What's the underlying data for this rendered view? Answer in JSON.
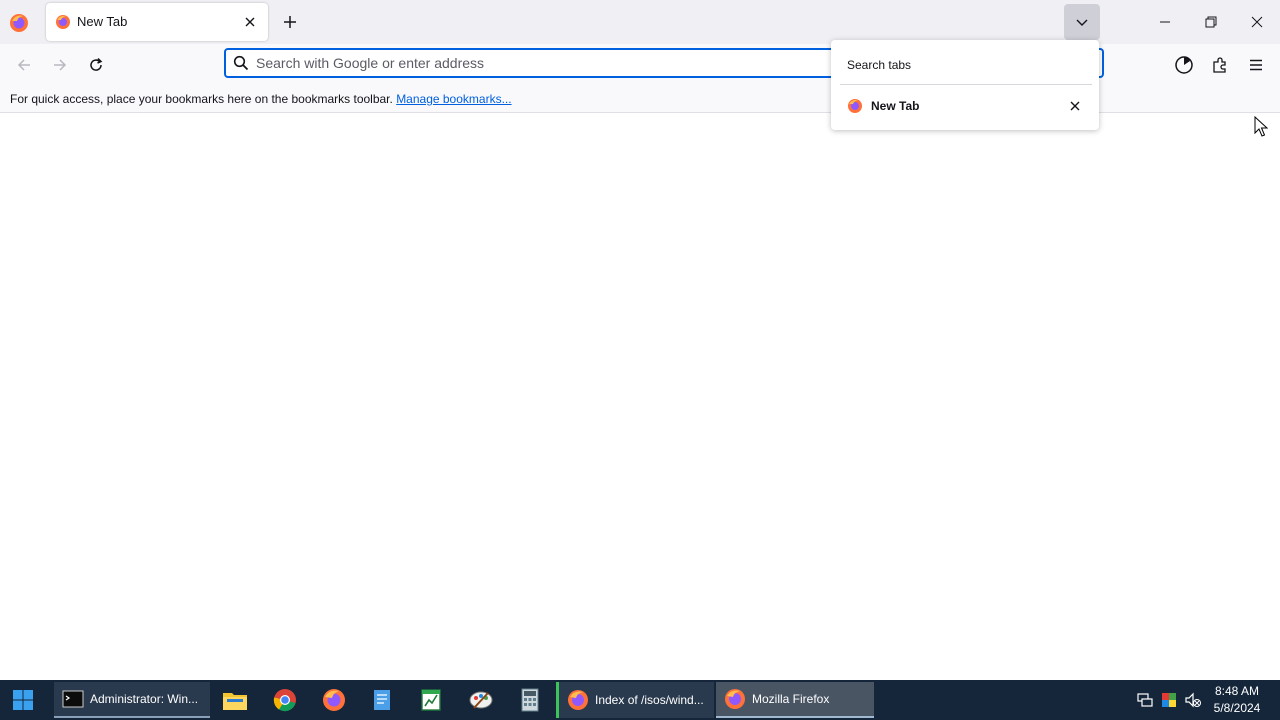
{
  "colors": {
    "tab_strip_bg": "#f0f0f4",
    "toolbar_bg": "#f9f9fb",
    "accent": "#0061e0",
    "link": "#0061e0",
    "taskbar_bg": "#15263a",
    "active_task_bg": "#4a5564"
  },
  "browser": {
    "app_icon": "firefox-icon",
    "tabs": [
      {
        "title": "New Tab",
        "icon": "firefox-icon",
        "active": true
      }
    ],
    "new_tab_icon": "plus-icon",
    "list_all_tabs_icon": "chevron-down-icon",
    "window_controls": [
      "minimize-icon",
      "restore-icon",
      "close-icon"
    ]
  },
  "navbar": {
    "back_icon": "back-arrow-icon",
    "forward_icon": "forward-arrow-icon",
    "reload_icon": "reload-icon",
    "url_placeholder": "Search with Google or enter address",
    "url_value": "",
    "right_icons": [
      "firefox-view-icon",
      "extensions-icon",
      "menu-icon"
    ]
  },
  "bookmarks_bar": {
    "message": "For quick access, place your bookmarks here on the bookmarks toolbar. ",
    "link": "Manage bookmarks..."
  },
  "tabs_popup": {
    "title": "Search tabs",
    "items": [
      {
        "label": "New Tab",
        "icon": "firefox-icon"
      }
    ]
  },
  "taskbar": {
    "start_icon": "windows-start-icon",
    "windows": [
      {
        "label": "Administrator: Win...",
        "icon": "terminal-icon"
      },
      {
        "label": "Index of /isos/wind...",
        "icon": "firefox-icon"
      },
      {
        "label": "Mozilla Firefox",
        "icon": "firefox-icon",
        "active": true
      }
    ],
    "pinned": [
      "file-explorer-icon",
      "chrome-icon",
      "firefox-icon",
      "notepad-icon",
      "spreadsheet-icon",
      "paint-icon",
      "calculator-icon"
    ],
    "tray_icons": [
      "network-icon",
      "color-icon",
      "volume-muted-icon"
    ],
    "time": "8:48 AM",
    "date": "5/8/2024"
  }
}
